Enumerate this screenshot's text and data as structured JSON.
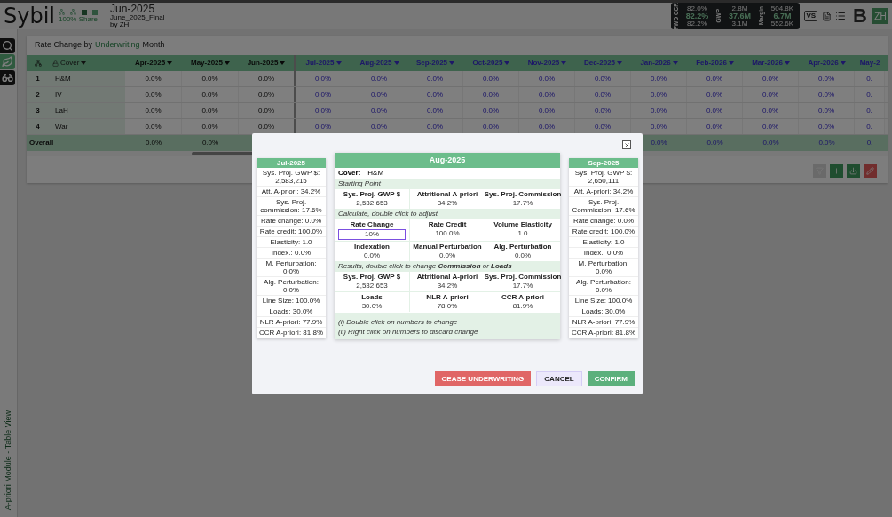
{
  "header": {
    "logo": "Sybil",
    "share": "100% Share",
    "title": "Jun-2025",
    "subtitle": "June_2025_Final",
    "author": "by ZH",
    "stats": [
      {
        "label": "FWD CCR",
        "values": [
          "82.0%",
          "82.2%",
          "82.2%"
        ]
      },
      {
        "label": "GWP",
        "values": [
          "2.8M",
          "37.6M",
          "3.1M"
        ]
      },
      {
        "label": "Margin",
        "values": [
          "504.8K",
          "6.7M",
          "552.6K"
        ]
      }
    ],
    "vs_label": "VS",
    "brand_letter": "B",
    "avatar": "ZH"
  },
  "sidebar": {
    "items": [
      {
        "kind": "search",
        "selected": false
      },
      {
        "kind": "leaf",
        "selected": true
      },
      {
        "kind": "glasses",
        "selected": false
      }
    ],
    "footer": "A-priori Module - Table View"
  },
  "table": {
    "title_parts": [
      {
        "text": "Rate Change by",
        "highlight": false
      },
      {
        "text": "Underwriting",
        "highlight": true
      },
      {
        "text": "Month",
        "highlight": false
      }
    ],
    "cover_header": "Cover",
    "columns": [
      {
        "label": "Apr-2025",
        "frozen": true
      },
      {
        "label": "May-2025",
        "frozen": true
      },
      {
        "label": "Jun-2025",
        "frozen": true
      },
      {
        "label": "Jul-2025",
        "frozen": false
      },
      {
        "label": "Aug-2025",
        "frozen": false
      },
      {
        "label": "Sep-2025",
        "frozen": false
      },
      {
        "label": "Oct-2025",
        "frozen": false
      },
      {
        "label": "Nov-2025",
        "frozen": false
      },
      {
        "label": "Dec-2025",
        "frozen": false
      },
      {
        "label": "Jan-2026",
        "frozen": false
      },
      {
        "label": "Feb-2026",
        "frozen": false
      },
      {
        "label": "Mar-2026",
        "frozen": false
      },
      {
        "label": "Apr-2026",
        "frozen": false
      },
      {
        "label": "May-2",
        "frozen": false
      }
    ],
    "rows": [
      {
        "index": "1",
        "cover": "H&M",
        "cells": [
          "0.0%",
          "0.0%",
          "0.0%",
          "0.0%",
          "0.0%",
          "0.0%",
          "0.0%",
          "0.0%",
          "0.0%",
          "0.0%",
          "0.0%",
          "0.0%",
          "0.0%",
          "0."
        ]
      },
      {
        "index": "2",
        "cover": "IV",
        "cells": [
          "0.0%",
          "0.0%",
          "0.0%",
          "0.0%",
          "0.0%",
          "0.0%",
          "0.0%",
          "0.0%",
          "0.0%",
          "0.0%",
          "0.0%",
          "0.0%",
          "0.0%",
          "0."
        ]
      },
      {
        "index": "3",
        "cover": "LaH",
        "cells": [
          "0.0%",
          "0.0%",
          "0.0%",
          "0.0%",
          "0.0%",
          "0.0%",
          "0.0%",
          "0.0%",
          "0.0%",
          "0.0%",
          "0.0%",
          "0.0%",
          "0.0%",
          "0."
        ]
      },
      {
        "index": "4",
        "cover": "War",
        "cells": [
          "0.0%",
          "0.0%",
          "0.0%",
          "0.0%",
          "0.0%",
          "0.0%",
          "0.0%",
          "0.0%",
          "0.0%",
          "0.0%",
          "0.0%",
          "0.0%",
          "0.0%",
          "0."
        ]
      }
    ],
    "overall": {
      "label": "Overall",
      "cells": [
        "0.0%",
        "0.0%",
        null,
        null,
        null,
        null,
        null,
        null,
        null,
        "0.0%",
        "0.0%",
        "0.0%",
        "0.0%",
        "0."
      ]
    },
    "tools": [
      {
        "kind": "filter",
        "disabled": true
      },
      {
        "kind": "add",
        "disabled": false
      },
      {
        "kind": "download",
        "disabled": false
      },
      {
        "kind": "edit",
        "disabled": false
      }
    ]
  },
  "modal": {
    "prev_card": {
      "title": "Jul-2025",
      "items": [
        "Sys. Proj. GWP $: 2,583,215",
        "Att. A-priori: 34.2%",
        "Sys. Proj. commission: 17.6%",
        "Rate change: 0.0%",
        "Rate credit: 100.0%",
        "Elasticity: 1.0",
        "Index.: 0.0%",
        "M. Perturbation: 0.0%",
        "Alg. Perturbation: 0.0%",
        "Line Size: 100.0%",
        "Loads: 30.0%",
        "NLR A-priori: 77.9%",
        "CCR A-priori: 81.8%"
      ]
    },
    "card": {
      "title": "Aug-2025",
      "cover_label": "Cover:",
      "cover": "H&M",
      "sections": [
        {
          "heading": "Starting Point",
          "fields": [
            {
              "label": "Sys. Proj. GWP $",
              "value": "2,532,653",
              "editing": false
            },
            {
              "label": "Attritional A-priori",
              "value": "34.2%",
              "editing": false
            },
            {
              "label": "Sys. Proj. Commission",
              "value": "17.7%",
              "editing": false
            }
          ]
        },
        {
          "heading": "Calculate, double click to adjust",
          "fields": [
            {
              "label": "Rate Change",
              "value": "10%",
              "editing": true
            },
            {
              "label": "Rate Credit",
              "value": "100.0%",
              "editing": false
            },
            {
              "label": "Volume Elasticity",
              "value": "1.0",
              "editing": false
            },
            {
              "label": "Indexation",
              "value": "0.0%",
              "editing": false
            },
            {
              "label": "Manual Perturbation",
              "value": "0.0%",
              "editing": false
            },
            {
              "label": "Alg. Perturbation",
              "value": "0.0%",
              "editing": false
            }
          ]
        },
        {
          "heading": "Results, double click to change **Commission** or **Loads**",
          "fields": [
            {
              "label": "Sys. Proj. GWP $",
              "value": "2,532,653",
              "editing": false
            },
            {
              "label": "Attritional A-priori",
              "value": "34.2%",
              "editing": false
            },
            {
              "label": "Sys. Proj. Commission",
              "value": "17.7%",
              "editing": false
            },
            {
              "label": "Loads",
              "value": "30.0%",
              "editing": false
            },
            {
              "label": "NLR A-priori",
              "value": "78.0%",
              "editing": false
            },
            {
              "label": "CCR A-priori",
              "value": "81.9%",
              "editing": false
            }
          ]
        }
      ],
      "notes": [
        "(i) Double click on numbers to change",
        "(ii) Right click on numbers to discard change"
      ]
    },
    "next_card": {
      "title": "Sep-2025",
      "items": [
        "Sys. Proj. GWP $: 2,650,111",
        "Att. A-priori: 34.2%",
        "Sys. Proj. Commission: 17.6%",
        "Rate change: 0.0%",
        "Rate credit: 100.0%",
        "Elasticity: 1.0",
        "Index.: 0.0%",
        "M. Perturbation: 0.0%",
        "Alg. Perturbation: 0.0%",
        "Line Size: 100.0%",
        "Loads: 30.0%",
        "NLR A-priori: 77.9%",
        "CCR A-priori: 81.8%"
      ]
    },
    "buttons": [
      {
        "label": "CEASE UNDERWRITING",
        "kind": "danger"
      },
      {
        "label": "CANCEL",
        "kind": "secondary"
      },
      {
        "label": "CONFIRM",
        "kind": "primary"
      }
    ]
  }
}
